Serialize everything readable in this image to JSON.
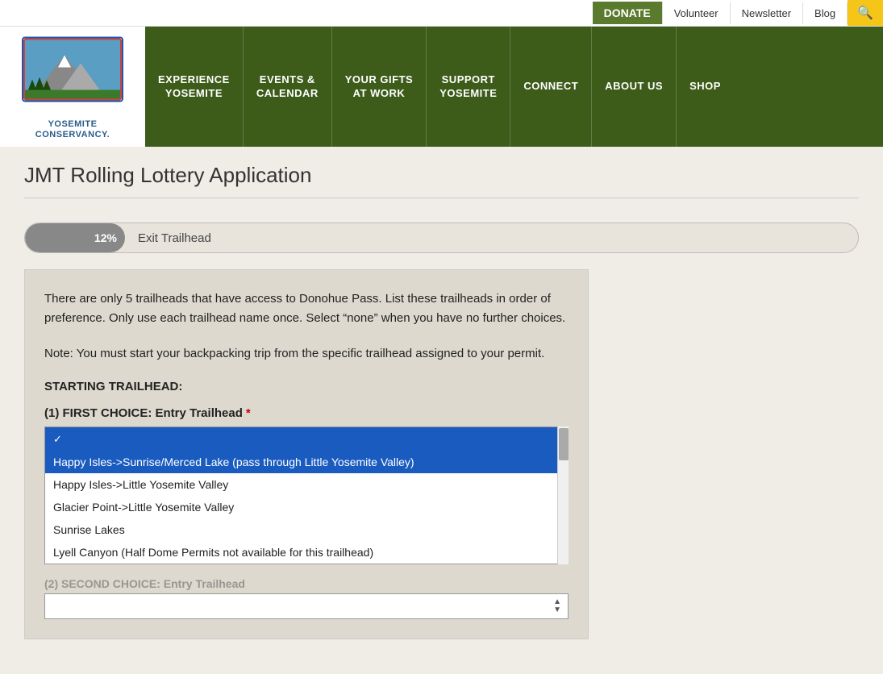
{
  "utility_bar": {
    "donate_label": "DONATE",
    "volunteer_label": "Volunteer",
    "newsletter_label": "Newsletter",
    "blog_label": "Blog",
    "search_icon": "🔍"
  },
  "header": {
    "logo_line1": "YOSEMITE",
    "logo_line2": "CONSERVANCY.",
    "nav_items": [
      {
        "id": "experience",
        "label": "EXPERIENCE\nYOSEMITE"
      },
      {
        "id": "events",
        "label": "EVENTS &\nCALENDAR"
      },
      {
        "id": "gifts",
        "label": "YOUR GIFTS\nAT WORK"
      },
      {
        "id": "support",
        "label": "SUPPORT\nYOSEMITE"
      },
      {
        "id": "connect",
        "label": "CONNECT"
      },
      {
        "id": "about",
        "label": "ABOUT US"
      },
      {
        "id": "shop",
        "label": "SHOP"
      }
    ]
  },
  "page": {
    "title": "JMT Rolling Lottery Application"
  },
  "progress": {
    "percent": "12%",
    "label": "Exit Trailhead"
  },
  "form": {
    "description1": "There are only 5 trailheads that have access to Donohue Pass. List these trailheads in order of preference. Only use each trailhead name once. Select “none” when you have no further choices.",
    "description2": "Note: You must start your backpacking trip from the specific trailhead assigned to your permit.",
    "section_title": "STARTING TRAILHEAD:",
    "first_choice_label": "(1) FIRST CHOICE: Entry Trailhead",
    "required": "*",
    "dropdown_options": [
      {
        "id": "blank",
        "label": ""
      },
      {
        "id": "happy_isles_sunrise",
        "label": "Happy Isles->Sunrise/Merced Lake (pass through Little Yosemite Valley)",
        "selected": true
      },
      {
        "id": "happy_isles_lyv",
        "label": "Happy Isles->Little Yosemite Valley"
      },
      {
        "id": "glacier_point",
        "label": "Glacier Point->Little Yosemite Valley"
      },
      {
        "id": "sunrise_lakes",
        "label": "Sunrise Lakes"
      },
      {
        "id": "lyell_canyon",
        "label": "Lyell Canyon (Half Dome Permits not available for this trailhead)"
      }
    ],
    "second_choice_label": "(2) SECOND CHOICE: Entry Trailhead"
  }
}
